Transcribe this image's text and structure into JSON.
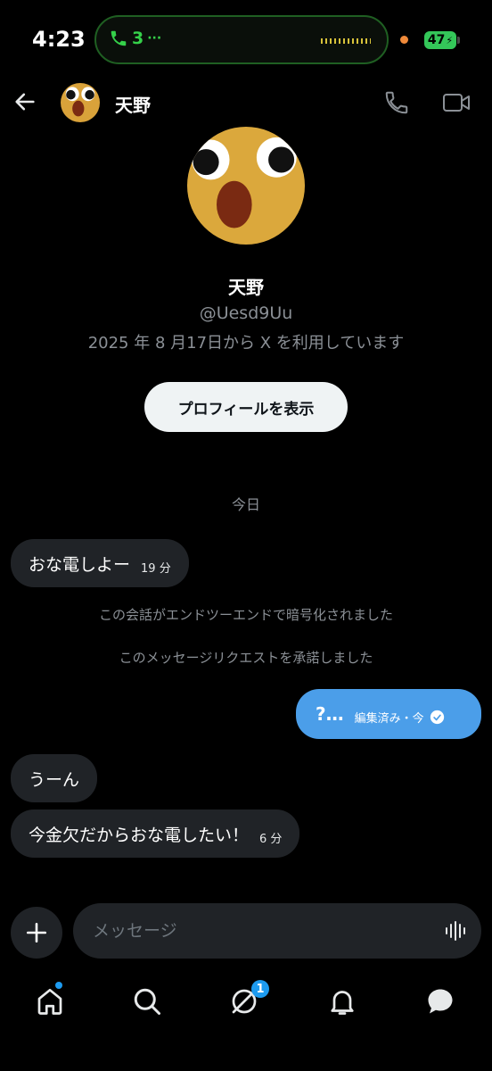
{
  "status": {
    "time": "4:23",
    "call_count": "3",
    "call_dots": "···",
    "battery": "47"
  },
  "header": {
    "name": "天野"
  },
  "profile": {
    "name": "天野",
    "handle": "@Uesd9Uu",
    "joined": "2025 年 8 月17日から X を利用しています",
    "view_button": "プロフィールを表示"
  },
  "date_separator": "今日",
  "messages": [
    {
      "text": "おな電しよー",
      "time": "19 分"
    },
    {
      "text": "?…",
      "edited": "編集済み・今"
    },
    {
      "text": "うーん"
    },
    {
      "text": "今金欠だからおな電したい！",
      "time": "6 分"
    }
  ],
  "system_messages": [
    "この会話がエンドツーエンドで暗号化されました",
    "このメッセージリクエストを承諾しました"
  ],
  "composer": {
    "placeholder": "メッセージ"
  },
  "tabs": {
    "messages_badge": "1"
  },
  "colors": {
    "accent": "#1d9bf0",
    "outgoing_bubble": "#4b9ee9",
    "incoming_bubble": "#202327",
    "call_green": "#35d14a",
    "battery_green": "#34c759"
  }
}
